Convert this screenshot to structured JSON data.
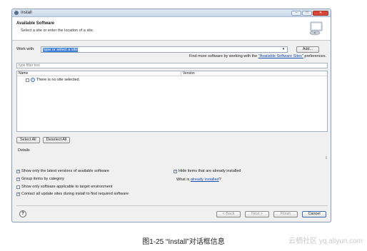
{
  "window": {
    "title": "Install",
    "header_title": "Available Software",
    "header_subtitle": "Select a site or enter the location of a site."
  },
  "work_with": {
    "label": "Work with:",
    "value": "type or select a site",
    "add_button": "Add..."
  },
  "hint": {
    "prefix": "Find more software by working with the ",
    "link": "\"Available Software Sites\"",
    "suffix": " preferences."
  },
  "filter": {
    "placeholder": "type filter text"
  },
  "table": {
    "columns": [
      "Name",
      "Version"
    ],
    "message": "There is no site selected."
  },
  "selection_buttons": {
    "select_all": "Select All",
    "deselect_all": "Deselect All"
  },
  "details": {
    "label": "Details"
  },
  "options": {
    "latest_versions": {
      "label": "Show only the latest versions of available software",
      "checked": true
    },
    "group_by_category": {
      "label": "Group items by category",
      "checked": true
    },
    "target_env": {
      "label": "Show only software applicable to target environment",
      "checked": false
    },
    "contact_sites": {
      "label": "Contact all update sites during install to find required software",
      "checked": true
    },
    "hide_installed": {
      "label": "Hide items that are already installed",
      "checked": true
    }
  },
  "whatis": {
    "prefix": "What is ",
    "link": "already installed",
    "suffix": "?"
  },
  "nav": {
    "back": "< Back",
    "next": "Next >",
    "finish": "Finish",
    "cancel": "Cancel"
  },
  "caption": "图1-25 “Install”对话框信息",
  "watermark": "云栖社区 yq.aliyun.com"
}
